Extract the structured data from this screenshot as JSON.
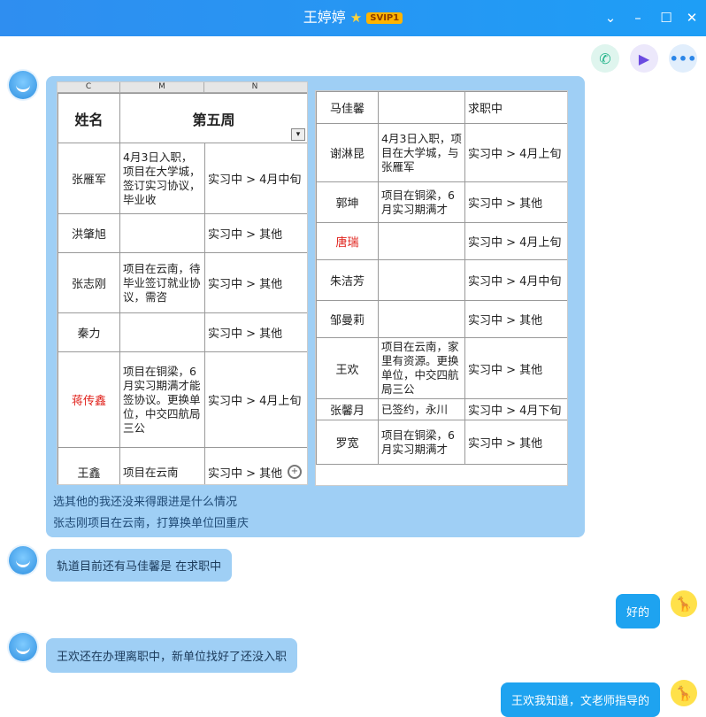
{
  "window": {
    "title": "王婷婷",
    "vip": "SVIP1",
    "controls": [
      "chevron",
      "minimize",
      "maximize",
      "close"
    ]
  },
  "toolbar": {
    "icons": [
      "phone-icon",
      "video-icon",
      "more-icon"
    ]
  },
  "left_sheet": {
    "col_letters": [
      "C",
      "M",
      "N"
    ],
    "header": {
      "name": "姓名",
      "week": "第五周"
    },
    "rows": [
      {
        "name": "张雁军",
        "note": "4月3日入职，项目在大学城，签订实习协议，毕业收",
        "status": "实习中 > 4月中旬",
        "red": false
      },
      {
        "name": "洪肇旭",
        "note": "",
        "status": "实习中 > 其他",
        "red": false
      },
      {
        "name": "张志刚",
        "note": "项目在云南，待毕业签订就业协议，需咨",
        "status": "实习中 > 其他",
        "red": false
      },
      {
        "name": "秦力",
        "note": "",
        "status": "实习中 > 其他",
        "red": false
      },
      {
        "name": "蒋传鑫",
        "note": "项目在铜梁，6月实习期满才能签协议。更换单位，中交四航局三公",
        "status": "实习中 > 4月上旬",
        "red": true
      },
      {
        "name": "王鑫",
        "note": "项目在云南",
        "status": "实习中 > 其他",
        "red": false
      }
    ]
  },
  "right_sheet": {
    "rows": [
      {
        "name": "马佳馨",
        "note": "",
        "status": "求职中",
        "red": false
      },
      {
        "name": "谢淋昆",
        "note": "4月3日入职，项目在大学城，与张雁军",
        "status": "实习中 > 4月上旬",
        "red": false
      },
      {
        "name": "郭坤",
        "note": "项目在铜梁，6月实习期满才",
        "status": "实习中 > 其他",
        "red": false
      },
      {
        "name": "唐瑞",
        "note": "",
        "status": "实习中 > 4月上旬",
        "red": true
      },
      {
        "name": "朱洁芳",
        "note": "",
        "status": "实习中 > 4月中旬",
        "red": false
      },
      {
        "name": "邹曼莉",
        "note": "",
        "status": "实习中 > 其他",
        "red": false
      },
      {
        "name": "王欢",
        "note": "项目在云南，家里有资源。更换单位，中交四航局三公",
        "status": "实习中 > 其他",
        "red": false
      },
      {
        "name": "张馨月",
        "note": "已签约，永川",
        "status": "实习中 > 4月下旬",
        "red": false
      },
      {
        "name": "罗宽",
        "note": "项目在铜梁，6月实习期满才",
        "status": "实习中 > 其他",
        "red": false
      }
    ]
  },
  "messages": {
    "m1_line1": "选其他的我还没来得跟进是什么情况",
    "m1_line2": "张志刚项目在云南，打算换单位回重庆",
    "m2": "轨道目前还有马佳馨是 在求职中",
    "m3": "好的",
    "m4": "王欢还在办理离职中，新单位找好了还没入职",
    "m5": "王欢我知道，文老师指导的"
  }
}
